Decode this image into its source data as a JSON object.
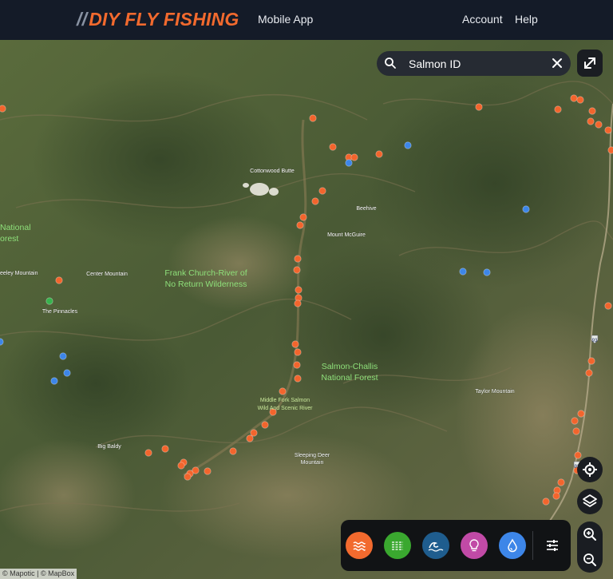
{
  "header": {
    "logo_text": "DIY FLY FISHING",
    "nav_mobile_app": "Mobile App",
    "nav_account": "Account",
    "nav_help": "Help"
  },
  "search": {
    "value": "Salmon ID",
    "icon": "search-icon"
  },
  "map": {
    "place_labels": [
      "Cottonwood Butte",
      "Beehive",
      "Mount McGuire",
      "Center Mountain",
      "eeley Mountain",
      "The Pinnacles",
      "Big Baldy",
      "Sleeping Deer Mountain",
      "Taylor Mountain"
    ],
    "area_labels": [
      "Frank Church-River of No Return Wilderness",
      "Salmon-Challis National Forest",
      "Middle Fork Salmon Wild And Scenic River",
      "National Forest"
    ],
    "highway_shields": [
      "93",
      "93"
    ],
    "colors": {
      "access_point": "#f2652d",
      "water_point": "#3d86e8",
      "green_point": "#37b24d",
      "area_label": "#8ee07a"
    }
  },
  "toolbar": {
    "buttons": [
      {
        "name": "river-layer-button",
        "color": "#f26a2e",
        "icon": "waves-icon"
      },
      {
        "name": "lake-layer-button",
        "color": "#3aa82f",
        "icon": "lake-icon"
      },
      {
        "name": "ocean-layer-button",
        "color": "#1f5d8e",
        "icon": "wave-icon"
      },
      {
        "name": "tips-layer-button",
        "color": "#c14aa6",
        "icon": "lightbulb-icon"
      },
      {
        "name": "water-layer-button",
        "color": "#3d86e8",
        "icon": "water-drop-icon"
      }
    ],
    "filter_icon": "sliders-icon"
  },
  "controls": {
    "expand_icon": "expand-icon",
    "locate_icon": "locate-icon",
    "layers_icon": "layers-icon",
    "zoom_in_icon": "zoom-in-icon",
    "zoom_out_icon": "zoom-out-icon"
  },
  "attribution": "© Mapotic | © MapBox"
}
